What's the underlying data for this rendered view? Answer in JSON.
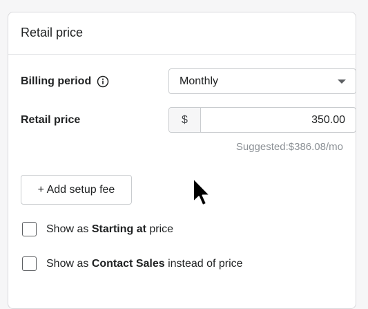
{
  "card": {
    "title": "Retail price"
  },
  "billing_period": {
    "label": "Billing period",
    "info_icon": "info-circle-icon",
    "selected": "Monthly"
  },
  "retail_price": {
    "label": "Retail price",
    "currency_prefix": "$",
    "value": "350.00",
    "suggested_prefix": "Suggested:",
    "suggested_value": "$386.08/mo"
  },
  "setup_fee": {
    "button_label": "+ Add setup fee"
  },
  "options": {
    "starting_at": {
      "pre": "Show as ",
      "bold": "Starting at",
      "post": " price",
      "checked": false
    },
    "contact_sales": {
      "pre": "Show as ",
      "bold": "Contact Sales",
      "post": " instead of price",
      "checked": false
    }
  },
  "pointer": "mouse-cursor-icon",
  "colors": {
    "text": "#202223",
    "muted": "#8c9196",
    "border": "#c9cccf"
  }
}
